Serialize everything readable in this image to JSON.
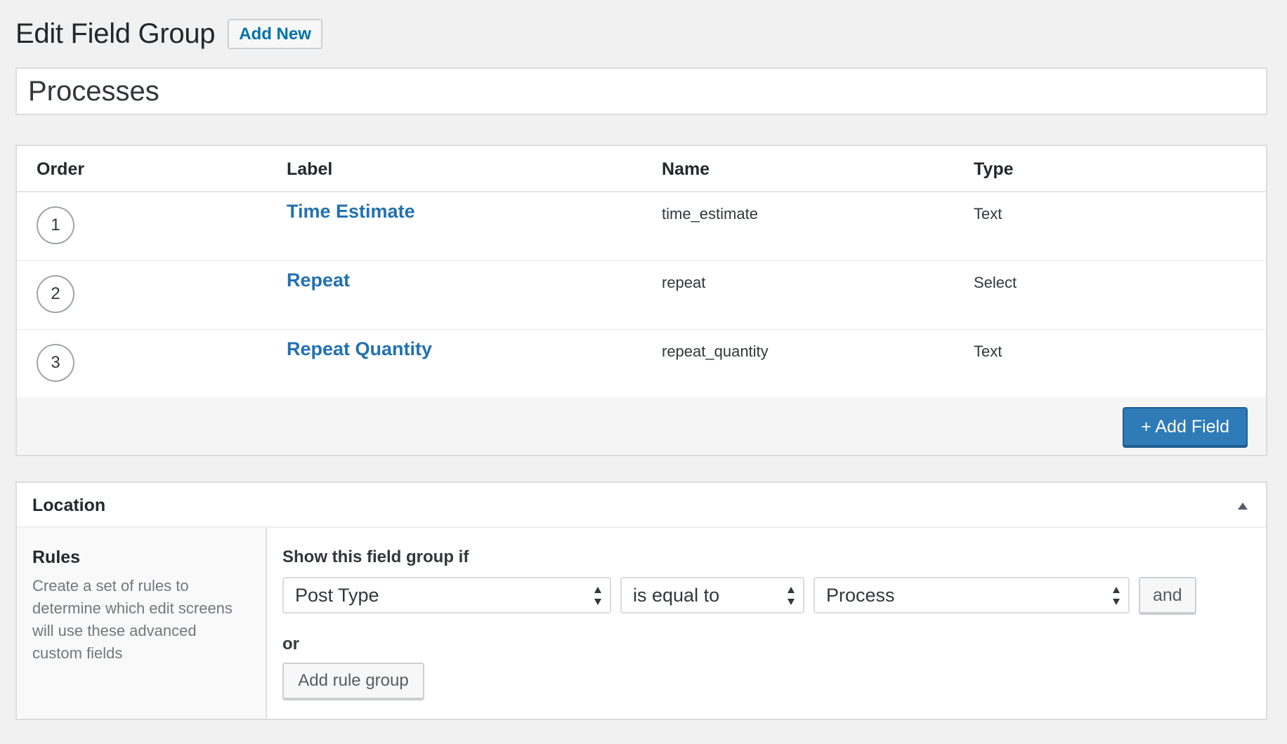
{
  "header": {
    "title": "Edit Field Group",
    "add_new_label": "Add New"
  },
  "title_input": {
    "value": "Processes"
  },
  "fields_table": {
    "columns": [
      "Order",
      "Label",
      "Name",
      "Type"
    ],
    "rows": [
      {
        "order": "1",
        "label": "Time Estimate",
        "name": "time_estimate",
        "type": "Text"
      },
      {
        "order": "2",
        "label": "Repeat",
        "name": "repeat",
        "type": "Select"
      },
      {
        "order": "3",
        "label": "Repeat Quantity",
        "name": "repeat_quantity",
        "type": "Text"
      }
    ],
    "add_field_label": "+ Add Field"
  },
  "location": {
    "title": "Location",
    "rules_title": "Rules",
    "rules_description": "Create a set of rules to determine which edit screens will use these advanced custom fields",
    "show_if_label": "Show this field group if",
    "rule": {
      "param": "Post Type",
      "operator": "is equal to",
      "value": "Process"
    },
    "and_label": "and",
    "or_label": "or",
    "add_rule_group_label": "Add rule group"
  },
  "colors": {
    "link": "#2271b1",
    "primary_button": "#2e7bb8",
    "background": "#f1f1f1"
  }
}
